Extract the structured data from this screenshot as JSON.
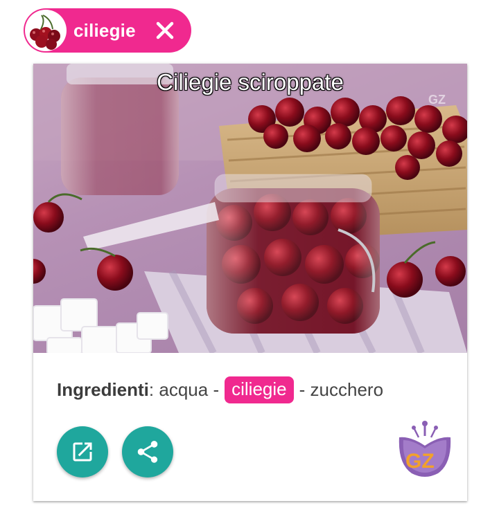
{
  "filter_chip": {
    "label": "ciliegie",
    "avatar_icon": "cherries-icon",
    "close_icon": "close-icon"
  },
  "recipe_card": {
    "title": "Ciliegie sciroppate",
    "ingredients_label": "Ingredienti",
    "ingredients_separator": ":",
    "ingredients": [
      {
        "name": "acqua",
        "highlighted": false
      },
      {
        "name": "ciliegie",
        "highlighted": true
      },
      {
        "name": "zucchero",
        "highlighted": false
      }
    ],
    "ingredient_divider": "-",
    "actions": [
      {
        "icon": "open-in-new-icon"
      },
      {
        "icon": "share-icon"
      }
    ],
    "logo_text": "GZ"
  },
  "colors": {
    "accent_pink": "#f0298f",
    "action_teal": "#1fa79d",
    "logo_purple": "#8a5fb4",
    "logo_orange": "#f2a12b"
  }
}
